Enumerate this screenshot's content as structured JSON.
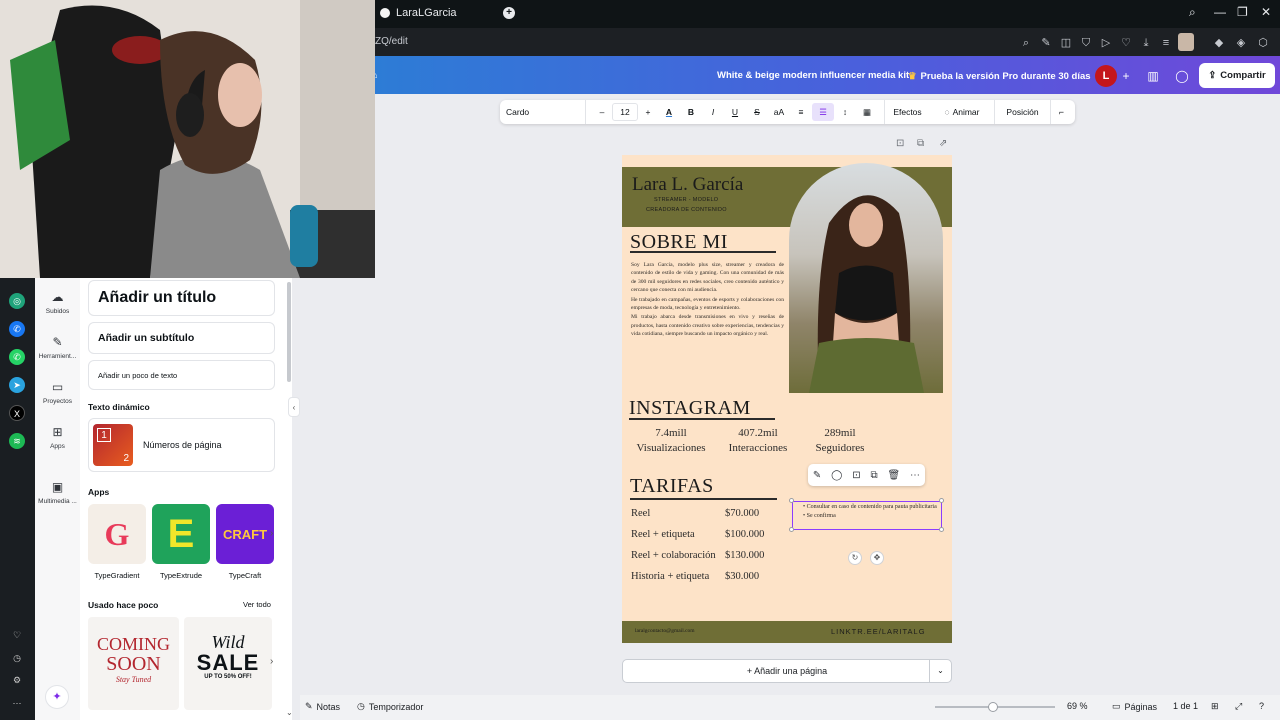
{
  "browser": {
    "tab_title": "LaraLGarcia",
    "url_fragment": "ZQ/edit",
    "new_tab_symbol": "+"
  },
  "canva": {
    "doc_title": "White & beige modern influencer media kit",
    "pro_trial": "Prueba la versión Pro durante 30 días",
    "avatar_initial": "L",
    "share_label": "Compartir"
  },
  "rail": {
    "items": [
      {
        "label": "Subidos",
        "icon": "cloud-upload-icon"
      },
      {
        "label": "Herramient...",
        "icon": "pencil-icon"
      },
      {
        "label": "Proyectos",
        "icon": "folder-icon"
      },
      {
        "label": "Apps",
        "icon": "apps-icon"
      },
      {
        "label": "Multimedia ...",
        "icon": "media-icon"
      }
    ]
  },
  "panel": {
    "add_title": "Añadir un título",
    "add_subtitle": "Añadir un subtítulo",
    "add_body": "Añadir un poco de texto",
    "dynamic_text_header": "Texto dinámico",
    "page_numbers_label": "Números de página",
    "apps_header": "Apps",
    "apps": [
      {
        "label": "TypeGradient",
        "color": "#f4eee7"
      },
      {
        "label": "TypeExtrude",
        "color": "#1fa35b"
      },
      {
        "label": "TypeCraft",
        "color": "#6b1fd6"
      }
    ],
    "recent_header": "Usado hace poco",
    "see_all": "Ver todo",
    "recent": [
      {
        "line1": "COMING",
        "line2": "SOON",
        "line3": "Stay Tuned"
      },
      {
        "line1": "Wild",
        "line2": "SALE",
        "line3": "UP TO 50% OFF!"
      }
    ]
  },
  "toolbar": {
    "font": "Cardo",
    "size": "12",
    "minus": "–",
    "plus": "+",
    "bold": "B",
    "italic": "I",
    "underline": "U",
    "strike": "S",
    "case": "aA",
    "effects": "Efectos",
    "animate": "Animar",
    "position": "Posición"
  },
  "design": {
    "name": "Lara L. García",
    "role_line1": "STREAMER - MODELO",
    "role_line2": "CREADORA DE CONTENIDO",
    "about_title": "SOBRE MI",
    "bio": [
      "Soy Lara García, modelo plus size, streamer y creadora de contenido de estilo de vida y gaming. Con una comunidad de más de 300 mil seguidores en redes sociales, creo contenido auténtico y cercano que conecta con mi audiencia.",
      "He trabajado en campañas, eventos de esports y colaboraciones con empresas de moda, tecnología y entretenimiento.",
      "Mi trabajo abarca desde transmisiones en vivo y reseñas de productos, hasta contenido creativo sobre experiencias, tendencias y vida cotidiana, siempre buscando un impacto orgánico y real."
    ],
    "instagram_title": "INSTAGRAM",
    "stats": [
      {
        "value": "7.4mill",
        "label": "Visualizaciones"
      },
      {
        "value": "407.2mil",
        "label": "Interacciones"
      },
      {
        "value": "289mil",
        "label": "Seguidores"
      }
    ],
    "rates_title": "TARIFAS",
    "rates": [
      {
        "name": "Reel",
        "price": "$70.000"
      },
      {
        "name": "Reel + etiqueta",
        "price": "$100.000"
      },
      {
        "name": "Reel + colaboración",
        "price": "$130.000"
      },
      {
        "name": "Historia + etiqueta",
        "price": "$30.000"
      }
    ],
    "notes": [
      "Consultar en caso de contenido para pauta publicitaria",
      "Se confirma"
    ],
    "email": "laralgcontacto@gmail.com",
    "link": "LINKTR.EE/LARITALG",
    "band_color": "#6f6e36",
    "bg_color": "#fde3c8"
  },
  "editor": {
    "add_page": "+ Añadir una página"
  },
  "footer": {
    "notes": "Notas",
    "timer": "Temporizador",
    "zoom": "69 %",
    "pages": "Páginas",
    "page_count": "1 de 1"
  },
  "colors": {
    "selection": "#8b3dff",
    "avatar": "#c4161c"
  }
}
